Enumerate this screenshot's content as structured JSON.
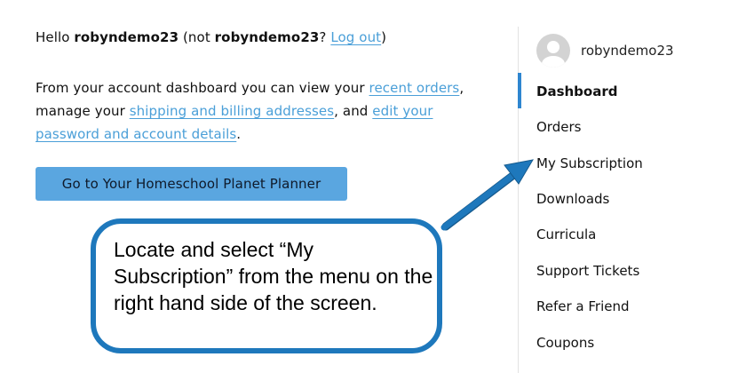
{
  "greeting": {
    "hello": "Hello ",
    "username": "robyndemo23",
    "not_prefix": " (not ",
    "not_username": "robyndemo23",
    "question": "? ",
    "logout_label": "Log out",
    "close_paren": ")"
  },
  "intro": {
    "part1": "From your account dashboard you can view your ",
    "recent_orders": "recent orders",
    "part2": ", manage your ",
    "addresses": "shipping and billing addresses",
    "part3": ", and ",
    "account_details": "edit your password and account details",
    "part4": "."
  },
  "planner_button": "Go to Your Homeschool Planet Planner",
  "callout_text": "Locate and select “My Subscription” from the menu on the right hand side of the screen.",
  "sidebar": {
    "username": "robyndemo23",
    "items": [
      {
        "label": "Dashboard",
        "active": true
      },
      {
        "label": "Orders"
      },
      {
        "label": "My Subscription"
      },
      {
        "label": "Downloads"
      },
      {
        "label": "Curricula"
      },
      {
        "label": "Support Tickets"
      },
      {
        "label": "Refer a Friend"
      },
      {
        "label": "Coupons"
      }
    ]
  },
  "colors": {
    "link": "#4a9fd8",
    "button": "#5aa6e0",
    "callout_border": "#1e78bc",
    "arrow": "#1e78bc",
    "active_bar": "#2e86d0"
  }
}
